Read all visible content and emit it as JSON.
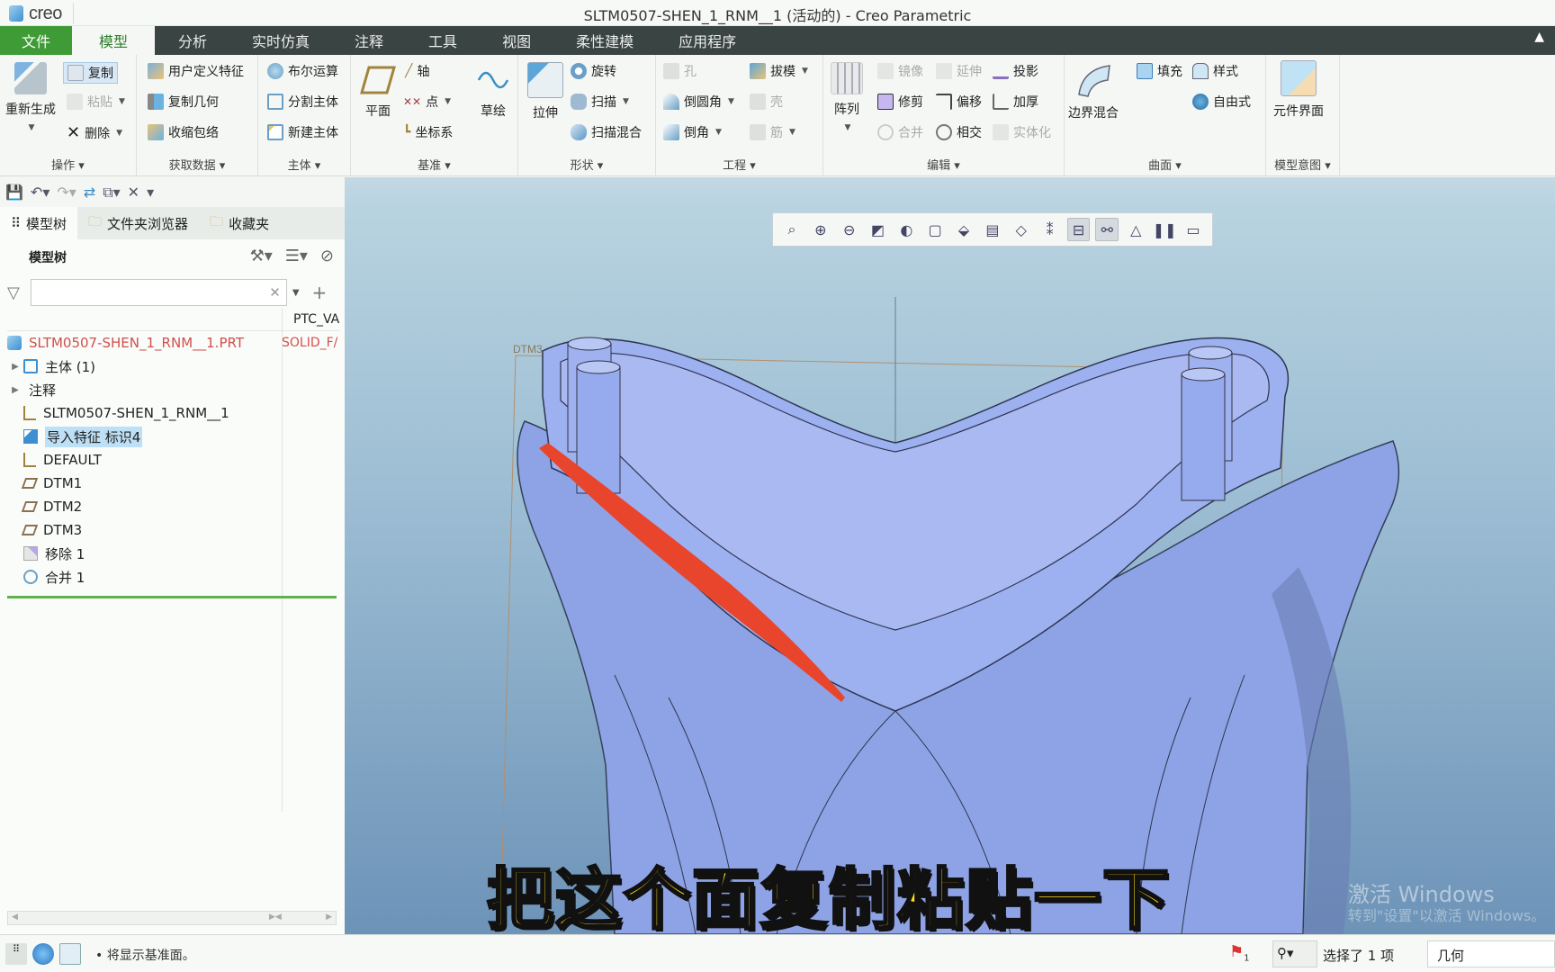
{
  "app": {
    "logo_text": "creo",
    "window_title": "SLTM0507-SHEN_1_RNM__1 (活动的) - Creo Parametric"
  },
  "menubar": {
    "items": [
      "文件",
      "模型",
      "分析",
      "实时仿真",
      "注释",
      "工具",
      "视图",
      "柔性建模",
      "应用程序"
    ],
    "active": "模型",
    "collapse_icon": "chevron-up-icon"
  },
  "ribbon": {
    "groups": [
      {
        "label": "操作",
        "items": {
          "regenerate": "重新生成",
          "copy": "复制",
          "paste": "粘贴",
          "delete": "删除"
        }
      },
      {
        "label": "获取数据",
        "items": {
          "udf": "用户定义特征",
          "copy_geom": "复制几何",
          "shrinkwrap": "收缩包络"
        }
      },
      {
        "label": "主体",
        "items": {
          "boolean": "布尔运算",
          "split": "分割主体",
          "new_body": "新建主体"
        }
      },
      {
        "label": "基准",
        "items": {
          "plane": "平面",
          "axis": "轴",
          "point": "点",
          "csys": "坐标系",
          "sketch": "草绘"
        }
      },
      {
        "label": "形状",
        "items": {
          "extrude": "拉伸",
          "revolve": "旋转",
          "sweep": "扫描",
          "swept_blend": "扫描混合"
        }
      },
      {
        "label": "工程",
        "items": {
          "hole": "孔",
          "round": "倒圆角",
          "chamfer": "倒角",
          "draft": "拔模",
          "shell": "壳",
          "rib": "筋"
        }
      },
      {
        "label": "编辑",
        "items": {
          "pattern": "阵列",
          "mirror": "镜像",
          "extend": "延伸",
          "project": "投影",
          "trim": "修剪",
          "offset": "偏移",
          "thicken": "加厚",
          "merge": "合并",
          "intersect": "相交",
          "solidify": "实体化"
        }
      },
      {
        "label": "曲面",
        "items": {
          "boundary_blend": "边界混合",
          "fill": "填充",
          "style": "样式",
          "freestyle": "自由式"
        }
      },
      {
        "label": "模型意图",
        "items": {
          "component_interface": "元件界面"
        }
      }
    ]
  },
  "panel": {
    "tabs": [
      "模型树",
      "文件夹浏览器",
      "收藏夹"
    ],
    "header": "模型树",
    "filter_placeholder": "",
    "column2_header": "PTC_VA",
    "tree": [
      {
        "label": "SLTM0507-SHEN_1_RNM__1.PRT",
        "col2": "SOLID_F/",
        "icon": "part-icon",
        "root": true
      },
      {
        "label": "主体 (1)",
        "icon": "body-icon",
        "expandable": true
      },
      {
        "label": "注释",
        "icon": "",
        "expandable": true
      },
      {
        "label": "SLTM0507-SHEN_1_RNM__1",
        "icon": "csys-icon"
      },
      {
        "label": "导入特征 标识4",
        "icon": "import-feature-icon",
        "selected": true
      },
      {
        "label": "DEFAULT",
        "icon": "csys-icon"
      },
      {
        "label": "DTM1",
        "icon": "datum-plane-icon"
      },
      {
        "label": "DTM2",
        "icon": "datum-plane-icon"
      },
      {
        "label": "DTM3",
        "icon": "datum-plane-icon"
      },
      {
        "label": "移除 1",
        "icon": "remove-icon"
      },
      {
        "label": "合并 1",
        "icon": "merge-icon"
      }
    ]
  },
  "viewport": {
    "datum_label": "DTM3",
    "subtitle": "把这个面复制粘贴一下",
    "watermark_title": "激活 Windows",
    "watermark_sub": "转到\"设置\"以激活 Windows。",
    "highlight_color": "#e8452c",
    "model_color": "#94a8ec"
  },
  "statusbar": {
    "message": "将显示基准面。",
    "flag_count": "1",
    "selection": "选择了 1 项",
    "filter_value": "几何"
  }
}
